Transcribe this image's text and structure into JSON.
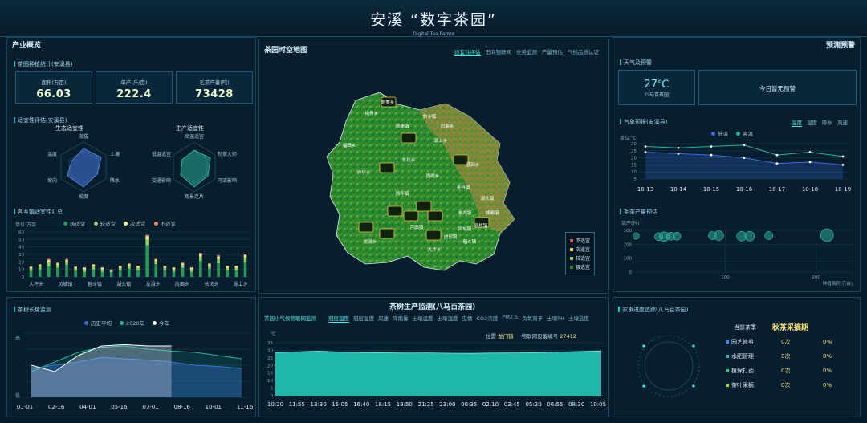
{
  "header": {
    "title": "安溪 “数字茶园”",
    "subtitle": "Digital Tea Farms"
  },
  "overview": {
    "title": "产业概览",
    "stats_title": "茶园种植统计(安溪县)",
    "stats": [
      {
        "label": "面积(万亩)",
        "value": "66.03"
      },
      {
        "label": "单产(斤/亩)",
        "value": "222.4"
      },
      {
        "label": "毛茶产量(吨)",
        "value": "73428"
      }
    ],
    "suit_title": "适宜性评估(安溪县)",
    "eco_label": "生态适宜性",
    "prod_label": "生产适宜性",
    "eco_axes": [
      "海拔",
      "土壤",
      "降水",
      "坡度",
      "坡向",
      "温度"
    ],
    "prod_axes": [
      "高温适宜",
      "制茶大师",
      "河流影响",
      "观景连片",
      "交通影响",
      "低温适宜"
    ],
    "towns_title": "各乡镇适宜性汇总",
    "towns_unit": "单位:万亩",
    "towns_legend": [
      {
        "name": "极适宜",
        "color": "#1e9e56"
      },
      {
        "name": "较适宜",
        "color": "#8fd05a"
      },
      {
        "name": "次适宜",
        "color": "#f0f08a"
      },
      {
        "name": "不适宜",
        "color": "#f08a6c"
      }
    ],
    "towns_yticks": [
      "60",
      "50",
      "40",
      "30",
      "20",
      "10",
      "0"
    ],
    "towns_xlabels": [
      "大坪乡",
      "凤城镇",
      "魁斗镇",
      "湖头镇",
      "龙涓乡",
      "尚卿乡",
      "长坑乡",
      "湖上乡"
    ]
  },
  "map": {
    "title": "茶园时空地图",
    "tabs": [
      "适宜性评估",
      "田间物联网",
      "长势监测",
      "产量预估",
      "气候品质认证"
    ],
    "towns": [
      "魁美乡",
      "桃舟乡",
      "剑斗镇",
      "感德镇",
      "白濑乡",
      "福田乡",
      "长坑乡",
      "湖上乡",
      "祥华乡",
      "尚卿乡",
      "蓝田乡",
      "金谷镇",
      "湖头镇",
      "西坪镇",
      "龙涓乡",
      "芦田镇",
      "参内镇",
      "城厢镇",
      "大坪乡",
      "凤城镇",
      "虎邱镇",
      "魁斗镇",
      "官桥镇"
    ],
    "legend": [
      {
        "name": "不适宜",
        "color": "#e0524a"
      },
      {
        "name": "次适宜",
        "color": "#e8d34a"
      },
      {
        "name": "较适宜",
        "color": "#8fcf4a"
      },
      {
        "name": "极适宜",
        "color": "#1f8a3a"
      }
    ]
  },
  "warning": {
    "title": "预测预警",
    "weather_title": "天气及预警",
    "temp": "27℃",
    "location": "八马百茶园",
    "alert": "今日暂无预警",
    "forecast_title": "气象预报(安溪县)",
    "forecast_tabs": [
      "温度",
      "湿度",
      "降水",
      "风速"
    ],
    "forecast_legend": [
      {
        "name": "低温",
        "color": "#3b6ce6"
      },
      {
        "name": "高温",
        "color": "#1fb89c"
      }
    ],
    "forecast_unit": "单位:℃",
    "forecast_yticks": [
      "30",
      "25",
      "20",
      "15",
      "10",
      "5"
    ],
    "forecast_dates": [
      "10-13",
      "10-14",
      "10-15",
      "10-16",
      "10-17",
      "10-18",
      "10-19"
    ],
    "yield_title": "毛茶产量预估",
    "yield_unit": "单产(斤)",
    "yield_yticks": [
      "300",
      "200",
      "100",
      "0"
    ],
    "yield_xticks": [
      "100",
      "200"
    ],
    "yield_xlabel": "种植面积(万亩)"
  },
  "growth": {
    "title": "茶树长势监测",
    "legend": [
      {
        "name": "历史平均",
        "color": "#3b6ce6"
      },
      {
        "name": "2020年",
        "color": "#1fb89c"
      },
      {
        "name": "今年",
        "color": "#ffffff"
      }
    ],
    "y_high": "高",
    "y_low": "低",
    "dates": [
      "01-01",
      "02-16",
      "04-01",
      "05-16",
      "07-01",
      "08-16",
      "10-01",
      "11-16"
    ]
  },
  "monitor": {
    "title": "茶树生产监测(八马百茶园)",
    "subtitle": "茶园小气候物联网监测",
    "tabs": [
      "冠层温度",
      "冠层湿度",
      "风速",
      "降雨量",
      "土壤温度",
      "土壤湿度",
      "虫情",
      "CO2浓度",
      "PM2.5",
      "负氧离子",
      "土壤PH",
      "土壤盐度"
    ],
    "location_label": "位置",
    "location": "龙门镇",
    "device_label": "物联网设备编号",
    "device_id": "27412",
    "unit": "℃",
    "yticks": [
      "35",
      "30",
      "25",
      "20",
      "15",
      "10",
      "5",
      "0"
    ],
    "times": [
      "10:20",
      "11:55",
      "13:30",
      "15:05",
      "16:40",
      "18:15",
      "19:50",
      "21:25",
      "23:00",
      "00:35",
      "02:10",
      "03:45",
      "05:20",
      "06:55",
      "08:30",
      "10:05"
    ]
  },
  "farming": {
    "title": "农事进度追踪(八马百茶园)",
    "season_label": "当前茶季",
    "season": "秋茶采摘期",
    "rows": [
      {
        "name": "园艺修剪",
        "count": "0次",
        "pct": "0%",
        "color": "#3b8fe6"
      },
      {
        "name": "水肥管理",
        "count": "0次",
        "pct": "0%",
        "color": "#1fb8b8"
      },
      {
        "name": "植保打药",
        "count": "0次",
        "pct": "0%",
        "color": "#39c96a"
      },
      {
        "name": "茶叶采摘",
        "count": "0次",
        "pct": "0%",
        "color": "#9fd84a"
      }
    ]
  },
  "chart_data": [
    {
      "type": "bar",
      "title": "各乡镇适宜性汇总",
      "ylabel": "单位:万亩",
      "ylim": [
        0,
        60
      ],
      "categories": [
        "大坪乡",
        "凤城镇",
        "魁斗镇",
        "湖头镇",
        "龙涓乡",
        "尚卿乡",
        "长坑乡",
        "湖上乡"
      ],
      "series": [
        {
          "name": "极适宜",
          "values": [
            8,
            10,
            14,
            12,
            16,
            8,
            7,
            10,
            7,
            6,
            9,
            11,
            9,
            42,
            17,
            9,
            7,
            12,
            7,
            21,
            11,
            18,
            9,
            9,
            19
          ]
        },
        {
          "name": "较适宜",
          "values": [
            3,
            4,
            5,
            4,
            4,
            3,
            3,
            4,
            3,
            2,
            3,
            4,
            3,
            8,
            4,
            3,
            3,
            4,
            3,
            6,
            4,
            6,
            3,
            3,
            7
          ]
        },
        {
          "name": "次适宜",
          "values": [
            2,
            2,
            3,
            2,
            2,
            2,
            2,
            2,
            2,
            1,
            2,
            2,
            2,
            4,
            2,
            2,
            2,
            2,
            2,
            3,
            2,
            3,
            2,
            2,
            3
          ]
        },
        {
          "name": "不适宜",
          "values": [
            1,
            1,
            2,
            1,
            2,
            1,
            1,
            1,
            1,
            1,
            1,
            1,
            1,
            2,
            1,
            1,
            1,
            1,
            1,
            2,
            1,
            2,
            1,
            1,
            2
          ]
        }
      ]
    },
    {
      "type": "line",
      "title": "气象预报(安溪县)",
      "ylabel": "单位:℃",
      "ylim": [
        5,
        30
      ],
      "x": [
        "10-13",
        "10-14",
        "10-15",
        "10-16",
        "10-17",
        "10-18",
        "10-19"
      ],
      "series": [
        {
          "name": "低温",
          "values": [
            24,
            23,
            22,
            20,
            16,
            17,
            15
          ]
        },
        {
          "name": "高温",
          "values": [
            28,
            27,
            28,
            29,
            22,
            24,
            21
          ]
        }
      ]
    },
    {
      "type": "scatter",
      "title": "毛茶产量预估",
      "ylabel": "单产(斤)",
      "xlabel": "种植面积(万亩)",
      "ylim": [
        0,
        300
      ],
      "xlim": [
        0,
        240
      ],
      "points": [
        {
          "x": 2,
          "y": 260,
          "r": 4
        },
        {
          "x": 27,
          "y": 255,
          "r": 5
        },
        {
          "x": 33,
          "y": 255,
          "r": 6
        },
        {
          "x": 40,
          "y": 258,
          "r": 5
        },
        {
          "x": 47,
          "y": 258,
          "r": 5
        },
        {
          "x": 86,
          "y": 262,
          "r": 5
        },
        {
          "x": 93,
          "y": 262,
          "r": 6
        },
        {
          "x": 118,
          "y": 258,
          "r": 6
        },
        {
          "x": 127,
          "y": 258,
          "r": 6
        },
        {
          "x": 148,
          "y": 262,
          "r": 5
        },
        {
          "x": 212,
          "y": 265,
          "r": 8
        }
      ]
    },
    {
      "type": "area",
      "title": "茶树长势监测",
      "x": [
        "01-01",
        "02-16",
        "04-01",
        "05-16",
        "07-01",
        "08-16",
        "10-01",
        "11-16"
      ],
      "series": [
        {
          "name": "历史平均",
          "values": [
            0.45,
            0.5,
            0.55,
            0.62,
            0.6,
            0.58,
            0.55,
            0.5,
            0.48,
            0.45
          ]
        },
        {
          "name": "2020年",
          "values": [
            0.4,
            0.55,
            0.7,
            0.78,
            0.8,
            0.75,
            0.72,
            0.7,
            0.65,
            0.6
          ]
        },
        {
          "name": "今年",
          "values": [
            0.5,
            0.4,
            0.65,
            0.8,
            0.82,
            0.8,
            0.8
          ]
        }
      ]
    },
    {
      "type": "area",
      "title": "茶园小气候物联网监测",
      "ylabel": "℃",
      "ylim": [
        0,
        35
      ],
      "x": [
        "10:20",
        "11:55",
        "13:30",
        "15:05",
        "16:40",
        "18:15",
        "19:50",
        "21:25",
        "23:00",
        "00:35",
        "02:10",
        "03:45",
        "05:20",
        "06:55",
        "08:30",
        "10:05"
      ],
      "series": [
        {
          "name": "冠层温度",
          "values": [
            28.5,
            29,
            29.5,
            28.8,
            28.6,
            28.4,
            28.2,
            28.3,
            28.1,
            28,
            28.2,
            28.3,
            28.5,
            28.8,
            29.2,
            29.6
          ]
        }
      ]
    }
  ]
}
